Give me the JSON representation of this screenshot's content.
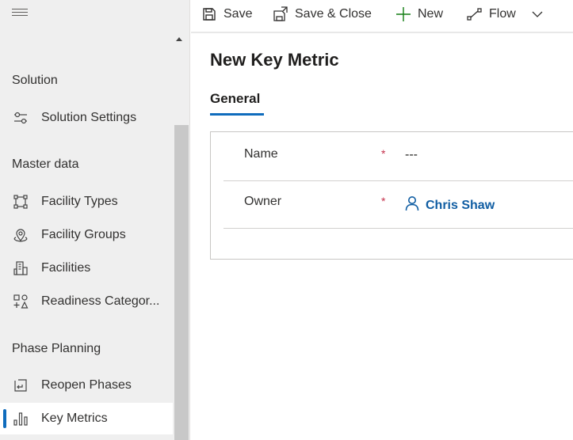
{
  "sidebar": {
    "sections": [
      {
        "title": "Solution",
        "items": [
          {
            "label": "Solution Settings",
            "icon": "settings-sliders-icon"
          }
        ]
      },
      {
        "title": "Master data",
        "items": [
          {
            "label": "Facility Types",
            "icon": "facility-types-icon"
          },
          {
            "label": "Facility Groups",
            "icon": "location-pin-icon"
          },
          {
            "label": "Facilities",
            "icon": "building-icon"
          },
          {
            "label": "Readiness Categor...",
            "icon": "shapes-icon"
          }
        ]
      },
      {
        "title": "Phase Planning",
        "items": [
          {
            "label": "Reopen Phases",
            "icon": "reopen-phases-icon"
          },
          {
            "label": "Key Metrics",
            "icon": "bar-chart-icon",
            "selected": true
          }
        ]
      }
    ]
  },
  "commandbar": {
    "save": "Save",
    "save_close": "Save & Close",
    "new": "New",
    "flow": "Flow"
  },
  "form": {
    "title": "New Key Metric",
    "tab": "General",
    "fields": {
      "name": {
        "label": "Name",
        "required": "*",
        "value": "---"
      },
      "owner": {
        "label": "Owner",
        "required": "*",
        "value": "Chris Shaw"
      }
    }
  },
  "colors": {
    "accent": "#0f6cbd",
    "required": "#c4314b",
    "link": "#115ea3",
    "sidebar_bg": "#efefef"
  }
}
